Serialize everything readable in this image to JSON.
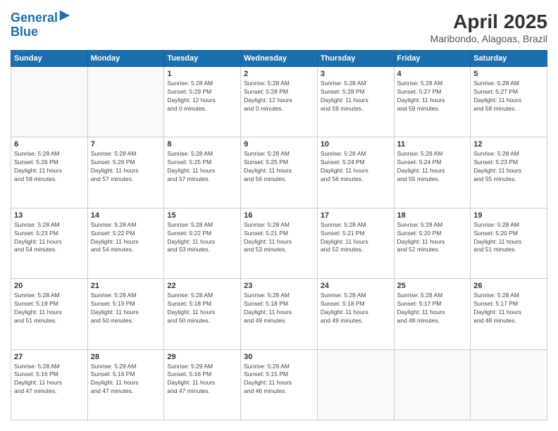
{
  "header": {
    "logo_line1": "General",
    "logo_line2": "Blue",
    "title": "April 2025",
    "subtitle": "Maribondo, Alagoas, Brazil"
  },
  "calendar": {
    "days_of_week": [
      "Sunday",
      "Monday",
      "Tuesday",
      "Wednesday",
      "Thursday",
      "Friday",
      "Saturday"
    ],
    "weeks": [
      [
        {
          "day": "",
          "detail": ""
        },
        {
          "day": "",
          "detail": ""
        },
        {
          "day": "1",
          "detail": "Sunrise: 5:28 AM\nSunset: 5:29 PM\nDaylight: 12 hours\nand 0 minutes."
        },
        {
          "day": "2",
          "detail": "Sunrise: 5:28 AM\nSunset: 5:28 PM\nDaylight: 12 hours\nand 0 minutes."
        },
        {
          "day": "3",
          "detail": "Sunrise: 5:28 AM\nSunset: 5:28 PM\nDaylight: 11 hours\nand 59 minutes."
        },
        {
          "day": "4",
          "detail": "Sunrise: 5:28 AM\nSunset: 5:27 PM\nDaylight: 11 hours\nand 59 minutes."
        },
        {
          "day": "5",
          "detail": "Sunrise: 5:28 AM\nSunset: 5:27 PM\nDaylight: 11 hours\nand 58 minutes."
        }
      ],
      [
        {
          "day": "6",
          "detail": "Sunrise: 5:28 AM\nSunset: 5:26 PM\nDaylight: 11 hours\nand 58 minutes."
        },
        {
          "day": "7",
          "detail": "Sunrise: 5:28 AM\nSunset: 5:26 PM\nDaylight: 11 hours\nand 57 minutes."
        },
        {
          "day": "8",
          "detail": "Sunrise: 5:28 AM\nSunset: 5:25 PM\nDaylight: 11 hours\nand 57 minutes."
        },
        {
          "day": "9",
          "detail": "Sunrise: 5:28 AM\nSunset: 5:25 PM\nDaylight: 11 hours\nand 56 minutes."
        },
        {
          "day": "10",
          "detail": "Sunrise: 5:28 AM\nSunset: 5:24 PM\nDaylight: 11 hours\nand 56 minutes."
        },
        {
          "day": "11",
          "detail": "Sunrise: 5:28 AM\nSunset: 5:24 PM\nDaylight: 11 hours\nand 55 minutes."
        },
        {
          "day": "12",
          "detail": "Sunrise: 5:28 AM\nSunset: 5:23 PM\nDaylight: 11 hours\nand 55 minutes."
        }
      ],
      [
        {
          "day": "13",
          "detail": "Sunrise: 5:28 AM\nSunset: 5:23 PM\nDaylight: 11 hours\nand 54 minutes."
        },
        {
          "day": "14",
          "detail": "Sunrise: 5:28 AM\nSunset: 5:22 PM\nDaylight: 11 hours\nand 54 minutes."
        },
        {
          "day": "15",
          "detail": "Sunrise: 5:28 AM\nSunset: 5:22 PM\nDaylight: 11 hours\nand 53 minutes."
        },
        {
          "day": "16",
          "detail": "Sunrise: 5:28 AM\nSunset: 5:21 PM\nDaylight: 11 hours\nand 53 minutes."
        },
        {
          "day": "17",
          "detail": "Sunrise: 5:28 AM\nSunset: 5:21 PM\nDaylight: 11 hours\nand 52 minutes."
        },
        {
          "day": "18",
          "detail": "Sunrise: 5:28 AM\nSunset: 5:20 PM\nDaylight: 11 hours\nand 52 minutes."
        },
        {
          "day": "19",
          "detail": "Sunrise: 5:28 AM\nSunset: 5:20 PM\nDaylight: 11 hours\nand 51 minutes."
        }
      ],
      [
        {
          "day": "20",
          "detail": "Sunrise: 5:28 AM\nSunset: 5:19 PM\nDaylight: 11 hours\nand 51 minutes."
        },
        {
          "day": "21",
          "detail": "Sunrise: 5:28 AM\nSunset: 5:19 PM\nDaylight: 11 hours\nand 50 minutes."
        },
        {
          "day": "22",
          "detail": "Sunrise: 5:28 AM\nSunset: 5:18 PM\nDaylight: 11 hours\nand 50 minutes."
        },
        {
          "day": "23",
          "detail": "Sunrise: 5:28 AM\nSunset: 5:18 PM\nDaylight: 11 hours\nand 49 minutes."
        },
        {
          "day": "24",
          "detail": "Sunrise: 5:28 AM\nSunset: 5:18 PM\nDaylight: 11 hours\nand 49 minutes."
        },
        {
          "day": "25",
          "detail": "Sunrise: 5:28 AM\nSunset: 5:17 PM\nDaylight: 11 hours\nand 48 minutes."
        },
        {
          "day": "26",
          "detail": "Sunrise: 5:28 AM\nSunset: 5:17 PM\nDaylight: 11 hours\nand 48 minutes."
        }
      ],
      [
        {
          "day": "27",
          "detail": "Sunrise: 5:28 AM\nSunset: 5:16 PM\nDaylight: 11 hours\nand 47 minutes."
        },
        {
          "day": "28",
          "detail": "Sunrise: 5:29 AM\nSunset: 5:16 PM\nDaylight: 11 hours\nand 47 minutes."
        },
        {
          "day": "29",
          "detail": "Sunrise: 5:29 AM\nSunset: 5:16 PM\nDaylight: 11 hours\nand 47 minutes."
        },
        {
          "day": "30",
          "detail": "Sunrise: 5:29 AM\nSunset: 5:15 PM\nDaylight: 11 hours\nand 46 minutes."
        },
        {
          "day": "",
          "detail": ""
        },
        {
          "day": "",
          "detail": ""
        },
        {
          "day": "",
          "detail": ""
        }
      ]
    ]
  }
}
